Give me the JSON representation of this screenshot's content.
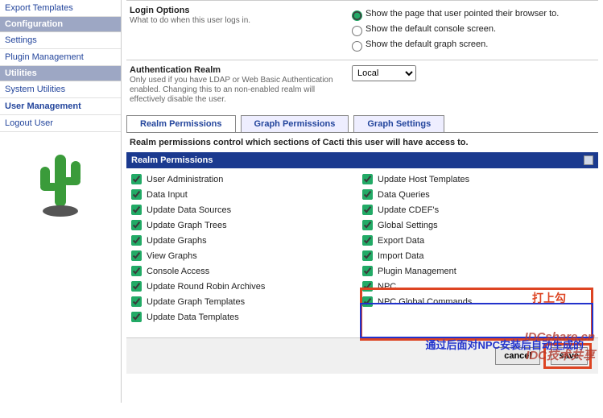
{
  "sidebar": {
    "items": [
      {
        "label": "Export Templates",
        "type": "link"
      },
      {
        "label": "Configuration",
        "type": "head"
      },
      {
        "label": "Settings",
        "type": "link"
      },
      {
        "label": "Plugin Management",
        "type": "link"
      },
      {
        "label": "Utilities",
        "type": "head"
      },
      {
        "label": "System Utilities",
        "type": "link"
      },
      {
        "label": "User Management",
        "type": "link",
        "sel": true
      },
      {
        "label": "Logout User",
        "type": "link"
      }
    ]
  },
  "formrows": {
    "login": {
      "title": "Login Options",
      "desc": "What to do when this user logs in."
    },
    "auth": {
      "title": "Authentication Realm",
      "desc": "Only used if you have LDAP or Web Basic Authentication enabled. Changing this to an non-enabled realm will effectively disable the user."
    }
  },
  "radios": {
    "r1": "Show the page that user pointed their browser to.",
    "r2": "Show the default console screen.",
    "r3": "Show the default graph screen."
  },
  "select": {
    "value": "Local"
  },
  "tabs": {
    "t1": "Realm Permissions",
    "t2": "Graph Permissions",
    "t3": "Graph Settings"
  },
  "desc": "Realm permissions control which sections of Cacti this user will have access to.",
  "panel": {
    "title": "Realm Permissions"
  },
  "perms": {
    "left": [
      "User Administration",
      "Data Input",
      "Update Data Sources",
      "Update Graph Trees",
      "Update Graphs",
      "View Graphs",
      "Console Access",
      "Update Round Robin Archives",
      "Update Graph Templates",
      "Update Data Templates"
    ],
    "right": [
      "Update Host Templates",
      "Data Queries",
      "Update CDEF's",
      "Global Settings",
      "Export Data",
      "Import Data",
      "Plugin Management",
      "NPC",
      "NPC Global Commands"
    ]
  },
  "buttons": {
    "cancel": "cancel",
    "save": "save"
  },
  "annotations": {
    "a1": "打上勾",
    "a2": "通过后面对NPC安装后自动生成的",
    "wm1": "IDCshare.cn",
    "wm2": "IDC技术共享"
  }
}
